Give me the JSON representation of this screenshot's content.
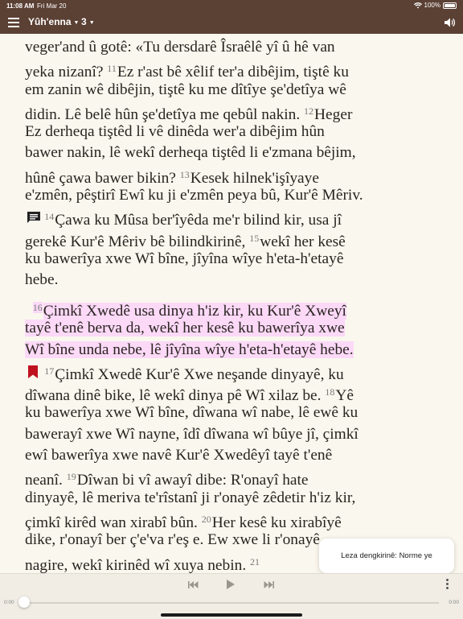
{
  "status_bar": {
    "time": "11:08 AM",
    "date": "Fri Mar 20",
    "battery": "100%"
  },
  "header": {
    "book": "Yûh'enna",
    "chapter": "3"
  },
  "paragraphs": [
    {
      "lines": [
        [
          {
            "t": "veger'and û gotê: «Tu dersdarê Îsraêlê yî û hê van"
          }
        ],
        [
          {
            "t": "yeka nizanî? "
          },
          {
            "v": "11"
          },
          {
            "t": "Ez r'ast bê xêlif ter'a dibêjim, tiştê ku"
          }
        ],
        [
          {
            "t": "em zanin wê dibêjin, tiştê ku me dîtîye şe'detîya wê"
          }
        ],
        [
          {
            "t": "didin. Lê belê hûn şe'detîya me qebûl nakin. "
          },
          {
            "v": "12"
          },
          {
            "t": "Heger"
          }
        ],
        [
          {
            "t": "Ez derheqa tiştêd li vê dinêda wer'a dibêjim hûn"
          }
        ],
        [
          {
            "t": "bawer nakin, lê wekî derheqa tiştêd li e'zmana bêjim,"
          }
        ],
        [
          {
            "t": "hûnê çawa bawer bikin? "
          },
          {
            "v": "13"
          },
          {
            "t": "Kesek hilnek'işîyaye"
          }
        ],
        [
          {
            "t": "e'zmên, pêştirî Ewî ku ji e'zmên peya bû, Kur'ê Mêriv."
          }
        ],
        [
          {
            "t": "     "
          },
          {
            "v": "14"
          },
          {
            "t": "Çawa ku Mûsa ber'îyêda me'r bilind kir, usa jî"
          }
        ],
        [
          {
            "t": "gerekê Kur'ê Mêriv bê bilindkirinê, "
          },
          {
            "v": "15"
          },
          {
            "t": "wekî her kesê"
          }
        ],
        [
          {
            "t": "ku bawerîya xwe Wî bîne, jîyîna wîye h'eta-h'etayê"
          }
        ],
        [
          {
            "t": "hebe."
          }
        ]
      ]
    },
    {
      "lines": [
        [
          {
            "t": "  "
          },
          {
            "v": "16",
            "hl": true
          },
          {
            "t": "Çimkî Xwedê usa dinya h'iz kir, ku Kur'ê Xweyî",
            "hl": true
          }
        ],
        [
          {
            "t": "tayê t'enê berva da, wekî her kesê ku bawerîya xwe",
            "hl": true
          }
        ],
        [
          {
            "t": "Wî bîne unda nebe, lê jîyîna wîye h'eta-h'etayê hebe.",
            "hl": true
          }
        ],
        [
          {
            "t": "     "
          },
          {
            "v": "17"
          },
          {
            "t": "Çimkî Xwedê Kur'ê Xwe neşande dinyayê, ku"
          }
        ],
        [
          {
            "t": "dîwana dinê bike, lê wekî dinya pê Wî xilaz be. "
          },
          {
            "v": "18"
          },
          {
            "t": "Yê"
          }
        ],
        [
          {
            "t": "ku bawerîya xwe Wî bîne, dîwana wî nabe, lê ewê ku"
          }
        ],
        [
          {
            "t": "bawerayî xwe Wî nayne, îdî dîwana wî bûye jî, çimkî"
          }
        ],
        [
          {
            "t": "ewî bawerîya xwe navê Kur'ê Xwedêyî tayê t'enê"
          }
        ],
        [
          {
            "t": "neanî. "
          },
          {
            "v": "19"
          },
          {
            "t": "Dîwan bi vî awayî dibe: R'onayî hate"
          }
        ],
        [
          {
            "t": "dinyayê, lê meriva te'rîstanî ji r'onayê zêdetir h'iz kir,"
          }
        ],
        [
          {
            "t": "çimkî kirêd wan xirabî bûn. "
          },
          {
            "v": "20"
          },
          {
            "t": "Her kesê ku xirabîyê"
          }
        ],
        [
          {
            "t": "dike, r'onayî ber ç'e'va r'eş e. Ew xwe li r'onayê"
          }
        ],
        [
          {
            "t": "nagire, wekî kirinêd wî xuya nebin. "
          },
          {
            "v": "21"
          }
        ]
      ]
    }
  ],
  "tooltip": {
    "text": "Leza dengkirinê: Norme ye"
  },
  "player": {
    "time_start": "0:00",
    "time_end": "0:00",
    "progress": 0
  },
  "colors": {
    "header_bg": "#5b4034",
    "page_bg": "#faf7ee",
    "highlight": "#fbd9f7",
    "bookmark": "#c0121e"
  },
  "icons": [
    "menu-icon",
    "caret-down-icon",
    "speaker-icon",
    "note-icon",
    "bookmark-icon",
    "skip-back-icon",
    "play-icon",
    "skip-forward-icon",
    "more-vertical-icon",
    "wifi-icon",
    "battery-icon"
  ]
}
